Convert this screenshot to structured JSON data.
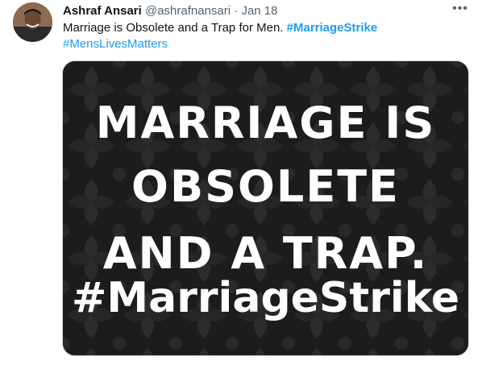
{
  "tweet": {
    "display_name": "Ashraf Ansari",
    "handle": "@ashrafnansari",
    "separator": "·",
    "date": "Jan 18",
    "more_icon": "more-dots-icon",
    "text": "Marriage is Obsolete and a Trap for Men.",
    "hashtags": [
      "#MarriageStrike",
      "#MensLivesMatters"
    ]
  },
  "media": {
    "lines": [
      "MARRIAGE IS",
      "OBSOLETE",
      "AND A TRAP.",
      "#MarriageStrike"
    ],
    "background_color": "#1f1f1f",
    "text_color": "#ffffff"
  },
  "colors": {
    "link": "#1d9bf0",
    "text": "#0f1419",
    "secondary": "#536471"
  }
}
